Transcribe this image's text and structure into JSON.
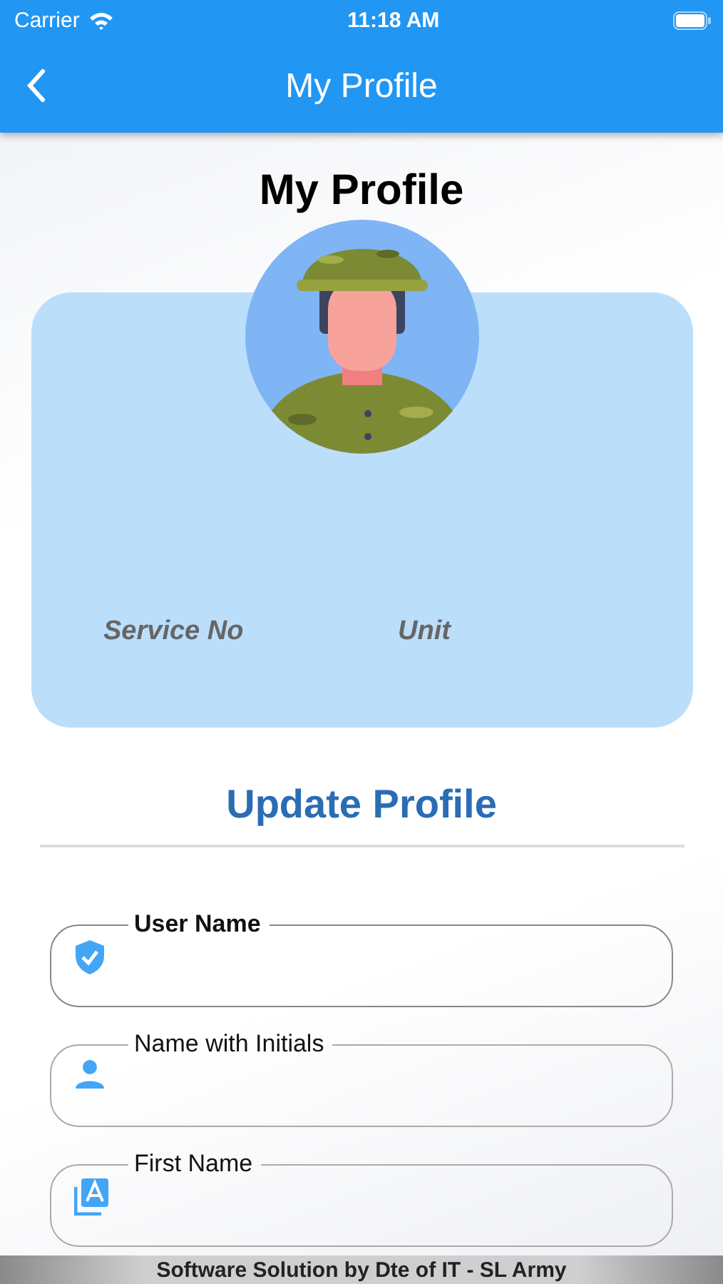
{
  "status_bar": {
    "carrier": "Carrier",
    "time": "11:18 AM"
  },
  "app_bar": {
    "title": "My Profile"
  },
  "heading": "My Profile",
  "profile_card": {
    "labels": [
      "Service No",
      "Unit"
    ]
  },
  "section_title": "Update Profile",
  "fields": [
    {
      "label": "User Name",
      "kind": "verified",
      "focused": true
    },
    {
      "label": "Name with Initials",
      "kind": "person",
      "focused": false
    },
    {
      "label": "First Name",
      "kind": "letter",
      "focused": false
    }
  ],
  "footer": "Software Solution by Dte of IT - SL Army"
}
